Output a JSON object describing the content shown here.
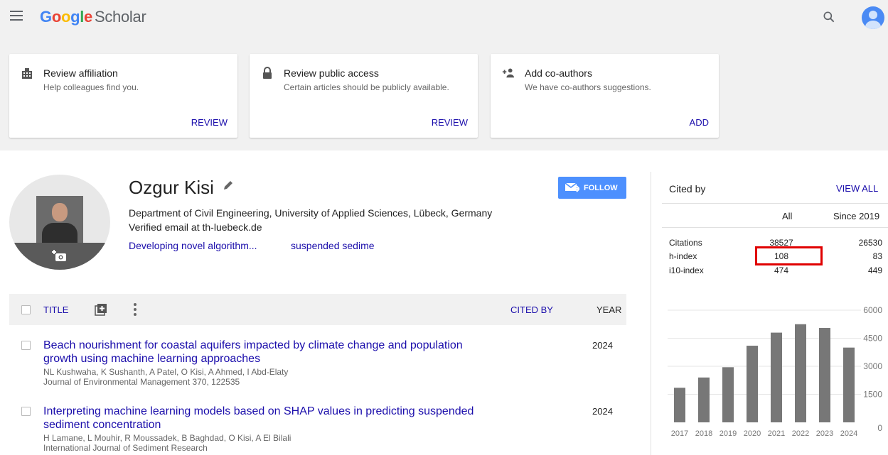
{
  "header": {
    "logo": {
      "G": "G",
      "o1": "o",
      "o2": "o",
      "g": "g",
      "l": "l",
      "e": "e",
      "scholar": "Scholar"
    }
  },
  "cards": [
    {
      "title": "Review affiliation",
      "desc": "Help colleagues find you.",
      "action": "REVIEW"
    },
    {
      "title": "Review public access",
      "desc": "Certain articles should be publicly available.",
      "action": "REVIEW"
    },
    {
      "title": "Add co-authors",
      "desc": "We have co-authors suggestions.",
      "action": "ADD"
    }
  ],
  "profile": {
    "name": "Ozgur Kisi",
    "affiliation": "Department of Civil Engineering, University of Applied Sciences, Lübeck, Germany",
    "email": "Verified email at th-luebeck.de",
    "interests": [
      "Developing novel algorithm...",
      "suspended sedime"
    ],
    "follow_label": "FOLLOW"
  },
  "table": {
    "title_label": "TITLE",
    "cited_by_label": "CITED BY",
    "year_label": "YEAR",
    "rows": [
      {
        "title": "Beach nourishment for coastal aquifers impacted by climate change and population growth using machine learning approaches",
        "authors": "NL Kushwaha, K Sushanth, A Patel, O Kisi, A Ahmed, I Abd-Elaty",
        "venue": "Journal of Environmental Management 370, 122535",
        "year": "2024"
      },
      {
        "title": "Interpreting machine learning models based on SHAP values in predicting suspended sediment concentration",
        "authors": "H Lamane, L Mouhir, R Moussadek, B Baghdad, O Kisi, A El Bilali",
        "venue": "International Journal of Sediment Research",
        "year": "2024"
      }
    ]
  },
  "cited_by": {
    "title": "Cited by",
    "view_all": "VIEW ALL",
    "col_all": "All",
    "col_since": "Since 2019",
    "rows": [
      {
        "label": "Citations",
        "all": "38527",
        "since": "26530"
      },
      {
        "label": "h-index",
        "all": "108",
        "since": "83"
      },
      {
        "label": "i10-index",
        "all": "474",
        "since": "449"
      }
    ]
  },
  "colors": {
    "link": "#1a0dab",
    "follow": "#4d90fe",
    "bar": "#777777",
    "highlight": "#e00000"
  },
  "chart_data": {
    "type": "bar",
    "categories": [
      "2017",
      "2018",
      "2019",
      "2020",
      "2021",
      "2022",
      "2023",
      "2024"
    ],
    "values": [
      1850,
      2400,
      2950,
      4100,
      4800,
      5250,
      5050,
      4000
    ],
    "ylim": [
      0,
      6000
    ],
    "yticks": [
      "6000",
      "4500",
      "3000",
      "1500",
      "0"
    ],
    "grid": true
  }
}
